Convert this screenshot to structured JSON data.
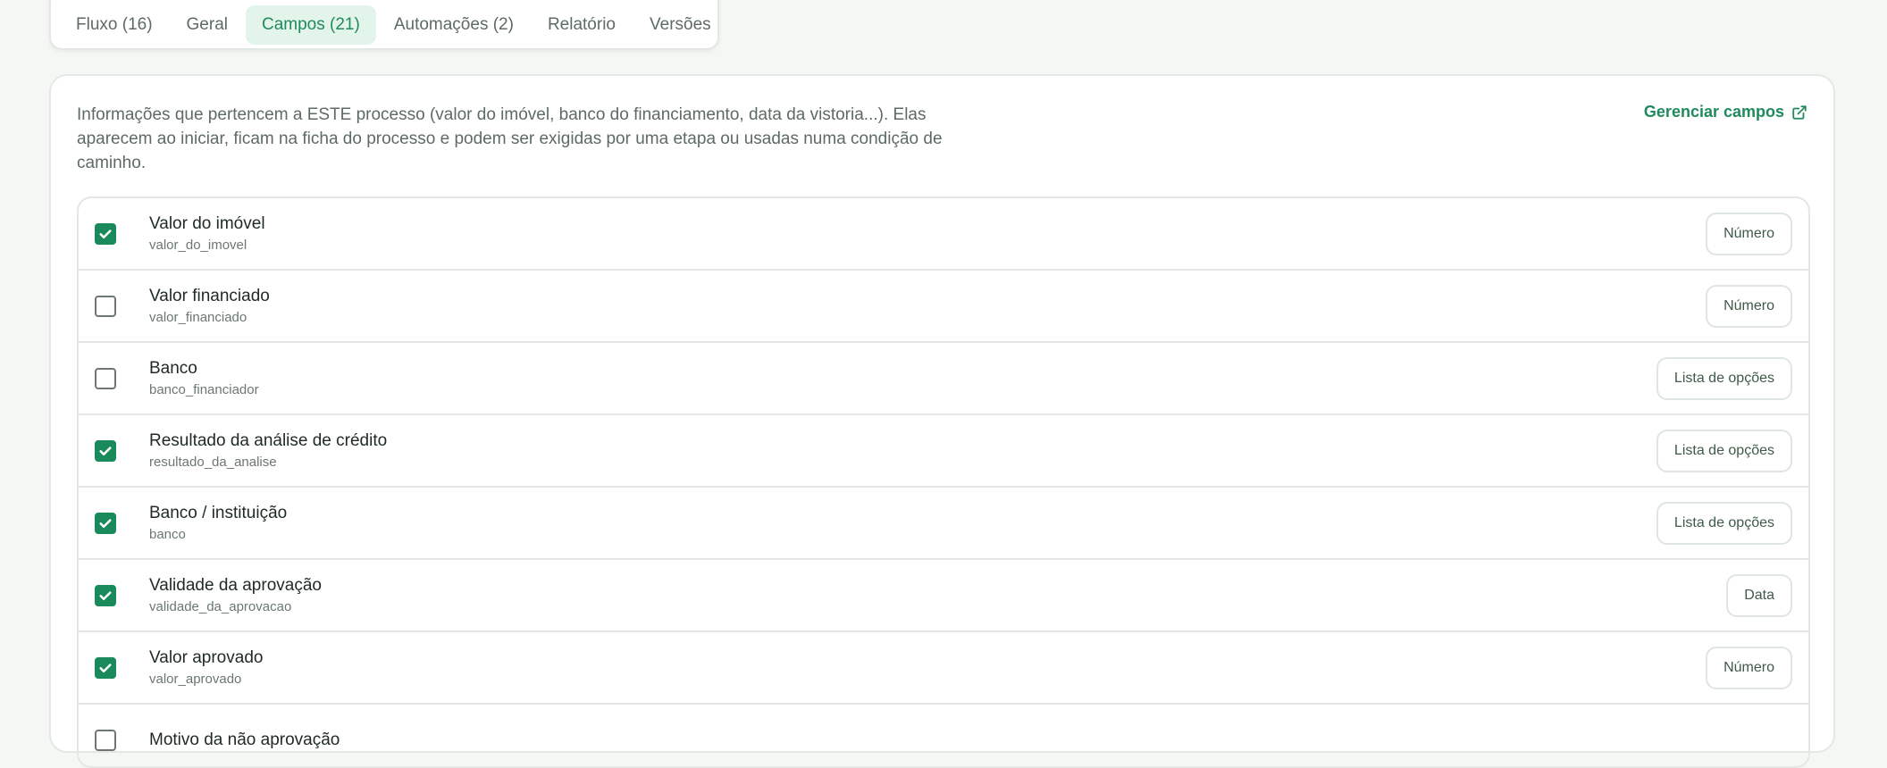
{
  "tabs": [
    {
      "label": "Fluxo (16)",
      "active": false
    },
    {
      "label": "Geral",
      "active": false
    },
    {
      "label": "Campos (21)",
      "active": true
    },
    {
      "label": "Automações (2)",
      "active": false
    },
    {
      "label": "Relatório",
      "active": false
    },
    {
      "label": "Versões",
      "active": false
    }
  ],
  "card": {
    "description": "Informações que pertencem a ESTE processo (valor do imóvel, banco do financiamento, data da vistoria...). Elas aparecem ao iniciar, ficam na ficha do processo e podem ser exigidas por uma etapa ou usadas numa condição de caminho.",
    "manage_label": "Gerenciar campos",
    "manage_icon": "external-link-icon"
  },
  "fields": [
    {
      "name": "Valor do imóvel",
      "key": "valor_do_imovel",
      "type": "Número",
      "checked": true
    },
    {
      "name": "Valor financiado",
      "key": "valor_financiado",
      "type": "Número",
      "checked": false
    },
    {
      "name": "Banco",
      "key": "banco_financiador",
      "type": "Lista de opções",
      "checked": false
    },
    {
      "name": "Resultado da análise de crédito",
      "key": "resultado_da_analise",
      "type": "Lista de opções",
      "checked": true
    },
    {
      "name": "Banco / instituição",
      "key": "banco",
      "type": "Lista de opções",
      "checked": true
    },
    {
      "name": "Validade da aprovação",
      "key": "validade_da_aprovacao",
      "type": "Data",
      "checked": true
    },
    {
      "name": "Valor aprovado",
      "key": "valor_aprovado",
      "type": "Número",
      "checked": true
    },
    {
      "name": "Motivo da não aprovação",
      "key": "",
      "type": "",
      "checked": false
    }
  ],
  "colors": {
    "accent": "#1f8a5c",
    "checkbox_checked": "#1a8a5a",
    "active_tab_bg": "#e3f4ea",
    "page_bg": "#f5f7f5",
    "border": "#e3e8e4"
  }
}
